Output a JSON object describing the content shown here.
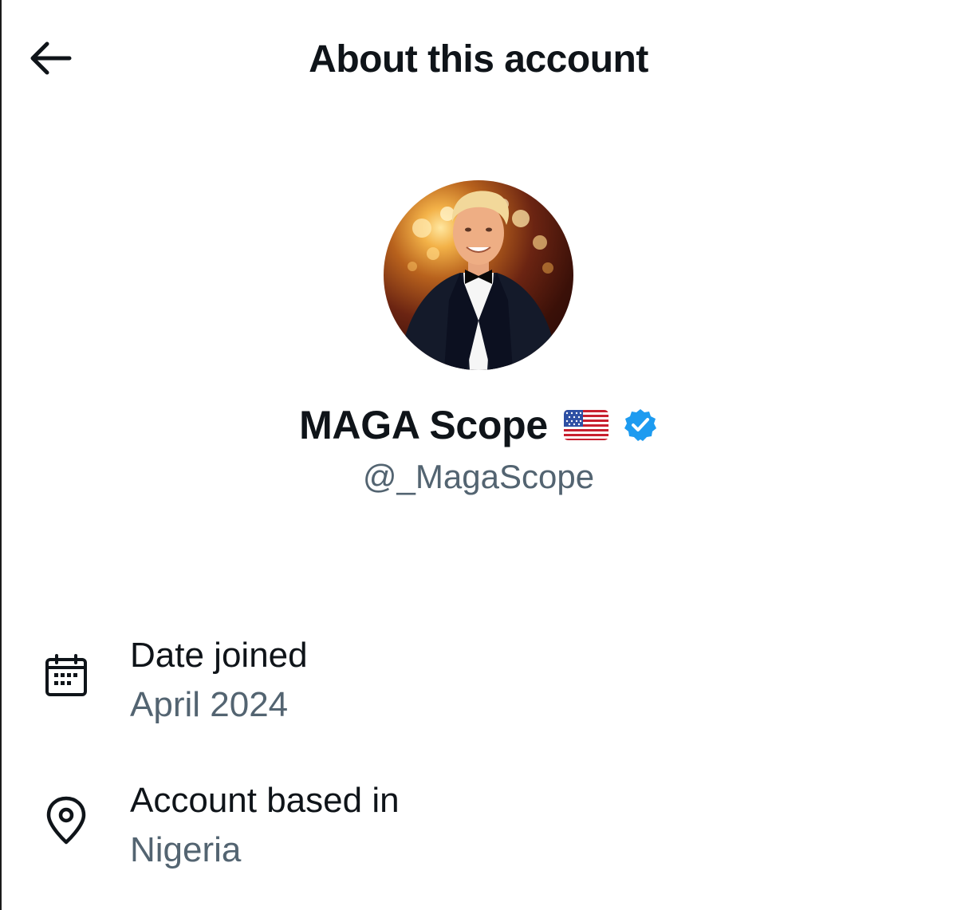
{
  "header": {
    "title": "About this account",
    "back_icon": "arrow-left-icon"
  },
  "profile": {
    "display_name": "MAGA Scope",
    "flag_emoji": "🇺🇸",
    "verified": true,
    "handle": "@_MagaScope",
    "avatar_icon": "profile-photo"
  },
  "details": [
    {
      "icon": "calendar-icon",
      "label": "Date joined",
      "value": "April 2024"
    },
    {
      "icon": "location-pin-icon",
      "label": "Account based in",
      "value": "Nigeria"
    }
  ],
  "colors": {
    "text_primary": "#0f1419",
    "text_secondary": "#536471",
    "verified_blue": "#1d9bf0"
  }
}
